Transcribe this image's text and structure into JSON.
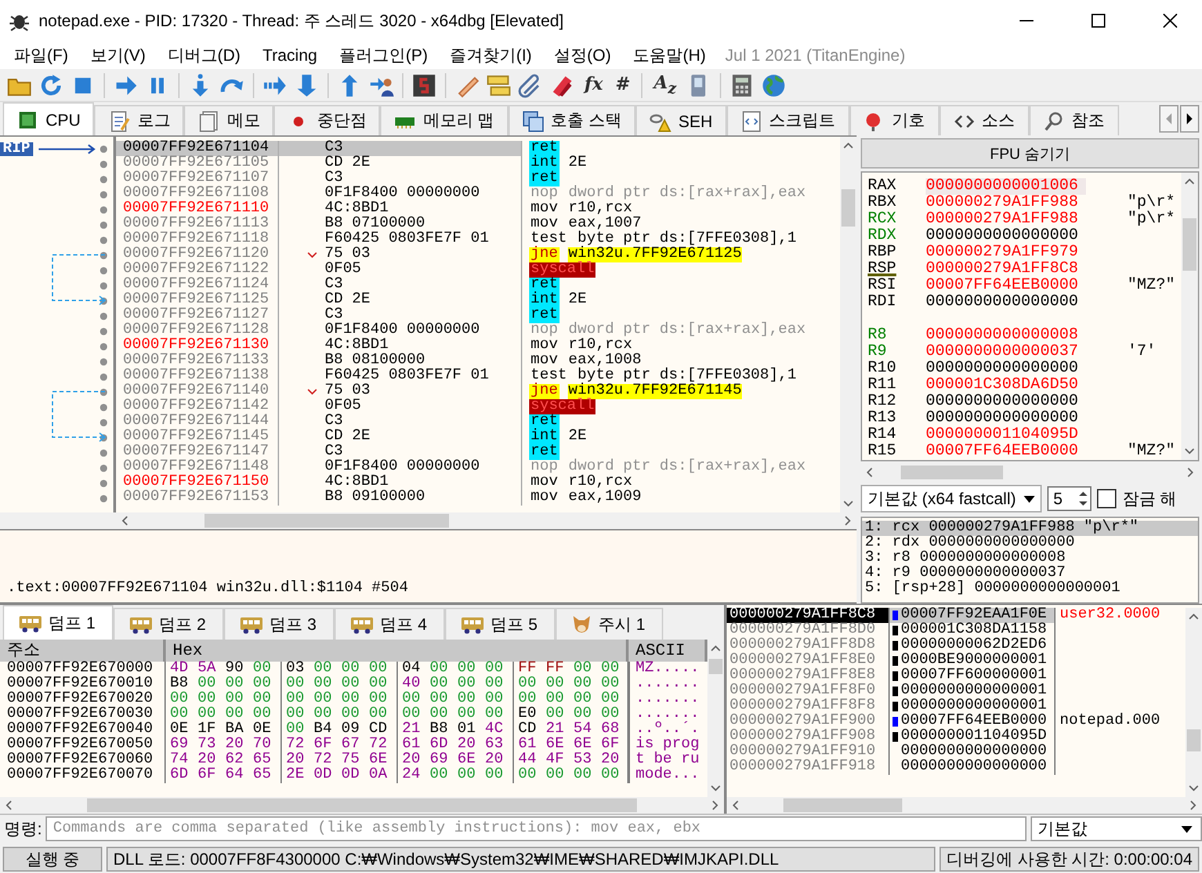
{
  "window": {
    "title": "notepad.exe - PID: 17320 - Thread: 주 스레드 3020 - x64dbg [Elevated]"
  },
  "menu": {
    "items": [
      "파일(F)",
      "보기(V)",
      "디버그(D)",
      "Tracing",
      "플러그인(P)",
      "즐겨찾기(I)",
      "설정(O)",
      "도움말(H)"
    ],
    "build_info": "Jul 1 2021 (TitanEngine)"
  },
  "toolbar": [
    {
      "kind": "open"
    },
    {
      "kind": "restart"
    },
    {
      "kind": "stop"
    },
    {
      "kind": "separator"
    },
    {
      "kind": "run"
    },
    {
      "kind": "pause"
    },
    {
      "kind": "separator"
    },
    {
      "kind": "step_into"
    },
    {
      "kind": "step_over"
    },
    {
      "kind": "separator"
    },
    {
      "kind": "trace_into"
    },
    {
      "kind": "trace_over"
    },
    {
      "kind": "separator"
    },
    {
      "kind": "run_till_return"
    },
    {
      "kind": "run_to_user"
    },
    {
      "kind": "separator"
    },
    {
      "kind": "plugin"
    },
    {
      "kind": "separator"
    },
    {
      "kind": "patches"
    },
    {
      "kind": "comments"
    },
    {
      "kind": "labels"
    },
    {
      "kind": "bookmarks"
    },
    {
      "kind": "glyph",
      "label": "fx"
    },
    {
      "kind": "glyph",
      "label": "#"
    },
    {
      "kind": "separator"
    },
    {
      "kind": "glyph",
      "label": "A$_{z}$"
    },
    {
      "kind": "device"
    },
    {
      "kind": "separator"
    },
    {
      "kind": "calculator"
    },
    {
      "kind": "globe"
    }
  ],
  "tabs": [
    {
      "label": "CPU",
      "selected": true
    },
    {
      "label": "로그",
      "selected": false
    },
    {
      "label": "메모",
      "selected": false
    },
    {
      "label": "중단점",
      "selected": false
    },
    {
      "label": "메모리 맵",
      "selected": false
    },
    {
      "label": "호출 스택",
      "selected": false
    },
    {
      "label": "SEH",
      "selected": false
    },
    {
      "label": "스크립트",
      "selected": false
    },
    {
      "label": "기호",
      "selected": false
    },
    {
      "label": "소스",
      "selected": false
    },
    {
      "label": "참조",
      "selected": false
    }
  ],
  "disassembly": {
    "rip_label": "RIP",
    "rows": [
      {
        "address": "00007FF92E671104",
        "color": "#000000",
        "bytes": "C3",
        "mnemonic": "ret",
        "kind": "ret",
        "branch_source": false,
        "branch_target": false,
        "selected": true
      },
      {
        "address": "00007FF92E671105",
        "color": "#808080",
        "bytes": "CD 2E",
        "mnemonic": "int",
        "operands": "2E",
        "kind": "int",
        "branch_source": false,
        "branch_target": false,
        "selected": false
      },
      {
        "address": "00007FF92E671107",
        "color": "#808080",
        "bytes": "C3",
        "mnemonic": "ret",
        "kind": "ret",
        "branch_source": false,
        "branch_target": false,
        "selected": false
      },
      {
        "address": "00007FF92E671108",
        "color": "#808080",
        "bytes": "0F1F8400 00000000",
        "mnemonic": "nop",
        "operands": "dword ptr ds:[rax+rax],eax",
        "kind": "nop",
        "branch_source": false,
        "branch_target": false,
        "selected": false
      },
      {
        "address": "00007FF92E671110",
        "color": "#ff0000",
        "bytes": "4C:8BD1",
        "mnemonic": "mov",
        "operands": "r10,rcx",
        "kind": "mov",
        "branch_source": false,
        "branch_target": false,
        "selected": false
      },
      {
        "address": "00007FF92E671113",
        "color": "#808080",
        "bytes": "B8 07100000",
        "mnemonic": "mov",
        "operands": "eax,1007",
        "kind": "mov",
        "branch_source": false,
        "branch_target": false,
        "selected": false
      },
      {
        "address": "00007FF92E671118",
        "color": "#808080",
        "bytes": "F60425 0803FE7F 01",
        "mnemonic": "test",
        "operands": "byte ptr ds:[7FFE0308],1",
        "kind": "test",
        "branch_source": false,
        "branch_target": false,
        "selected": false
      },
      {
        "address": "00007FF92E671120",
        "color": "#808080",
        "bytes": "75 03",
        "mnemonic": "jne",
        "operands": "win32u.7FF92E671125",
        "kind": "jne",
        "branch_source": true,
        "branch_target": false,
        "selected": false
      },
      {
        "address": "00007FF92E671122",
        "color": "#808080",
        "bytes": "0F05",
        "mnemonic": "syscall",
        "kind": "syscall",
        "branch_source": false,
        "branch_target": false,
        "selected": false
      },
      {
        "address": "00007FF92E671124",
        "color": "#808080",
        "bytes": "C3",
        "mnemonic": "ret",
        "kind": "ret",
        "branch_source": false,
        "branch_target": false,
        "selected": false
      },
      {
        "address": "00007FF92E671125",
        "color": "#808080",
        "bytes": "CD 2E",
        "mnemonic": "int",
        "operands": "2E",
        "kind": "int",
        "branch_source": false,
        "branch_target": true,
        "selected": false
      },
      {
        "address": "00007FF92E671127",
        "color": "#808080",
        "bytes": "C3",
        "mnemonic": "ret",
        "kind": "ret",
        "branch_source": false,
        "branch_target": false,
        "selected": false
      },
      {
        "address": "00007FF92E671128",
        "color": "#808080",
        "bytes": "0F1F8400 00000000",
        "mnemonic": "nop",
        "operands": "dword ptr ds:[rax+rax],eax",
        "kind": "nop",
        "branch_source": false,
        "branch_target": false,
        "selected": false
      },
      {
        "address": "00007FF92E671130",
        "color": "#ff0000",
        "bytes": "4C:8BD1",
        "mnemonic": "mov",
        "operands": "r10,rcx",
        "kind": "mov",
        "branch_source": false,
        "branch_target": false,
        "selected": false
      },
      {
        "address": "00007FF92E671133",
        "color": "#808080",
        "bytes": "B8 08100000",
        "mnemonic": "mov",
        "operands": "eax,1008",
        "kind": "mov",
        "branch_source": false,
        "branch_target": false,
        "selected": false
      },
      {
        "address": "00007FF92E671138",
        "color": "#808080",
        "bytes": "F60425 0803FE7F 01",
        "mnemonic": "test",
        "operands": "byte ptr ds:[7FFE0308],1",
        "kind": "test",
        "branch_source": false,
        "branch_target": false,
        "selected": false
      },
      {
        "address": "00007FF92E671140",
        "color": "#808080",
        "bytes": "75 03",
        "mnemonic": "jne",
        "operands": "win32u.7FF92E671145",
        "kind": "jne",
        "branch_source": true,
        "branch_target": false,
        "selected": false
      },
      {
        "address": "00007FF92E671142",
        "color": "#808080",
        "bytes": "0F05",
        "mnemonic": "syscall",
        "kind": "syscall",
        "branch_source": false,
        "branch_target": false,
        "selected": false
      },
      {
        "address": "00007FF92E671144",
        "color": "#808080",
        "bytes": "C3",
        "mnemonic": "ret",
        "kind": "ret",
        "branch_source": false,
        "branch_target": false,
        "selected": false
      },
      {
        "address": "00007FF92E671145",
        "color": "#808080",
        "bytes": "CD 2E",
        "mnemonic": "int",
        "operands": "2E",
        "kind": "int",
        "branch_source": false,
        "branch_target": true,
        "selected": false
      },
      {
        "address": "00007FF92E671147",
        "color": "#808080",
        "bytes": "C3",
        "mnemonic": "ret",
        "kind": "ret",
        "branch_source": false,
        "branch_target": false,
        "selected": false
      },
      {
        "address": "00007FF92E671148",
        "color": "#808080",
        "bytes": "0F1F8400 00000000",
        "mnemonic": "nop",
        "operands": "dword ptr ds:[rax+rax],eax",
        "kind": "nop",
        "branch_source": false,
        "branch_target": false,
        "selected": false
      },
      {
        "address": "00007FF92E671150",
        "color": "#ff0000",
        "bytes": "4C:8BD1",
        "mnemonic": "mov",
        "operands": "r10,rcx",
        "kind": "mov",
        "branch_source": false,
        "branch_target": false,
        "selected": false
      },
      {
        "address": "00007FF92E671153",
        "color": "#808080",
        "bytes": "B8 09100000",
        "mnemonic": "mov",
        "operands": "eax,1009",
        "kind": "mov",
        "branch_source": false,
        "branch_target": false,
        "selected": false
      }
    ]
  },
  "info_line": ".text:00007FF92E671104 win32u.dll:$1104 #504",
  "fpu_button": "FPU 숨기기",
  "registers": {
    "groups": [
      {
        "items": [
          {
            "name": "RAX",
            "color": "#000000",
            "value": "0000000000001006",
            "changed": true,
            "selected": true,
            "underlined": false
          },
          {
            "name": "RBX",
            "color": "#000000",
            "value": "000000279A1FF988",
            "changed": true,
            "selected": false,
            "underlined": false,
            "comment": "\"p\\r*"
          },
          {
            "name": "RCX",
            "color": "#008000",
            "value": "000000279A1FF988",
            "changed": true,
            "selected": false,
            "underlined": false,
            "comment": "\"p\\r*"
          },
          {
            "name": "RDX",
            "color": "#008000",
            "value": "0000000000000000",
            "changed": false,
            "selected": false,
            "underlined": false
          },
          {
            "name": "RBP",
            "color": "#000000",
            "value": "000000279A1FF979",
            "changed": true,
            "selected": false,
            "underlined": false
          },
          {
            "name": "RSP",
            "color": "#000000",
            "value": "000000279A1FF8C8",
            "changed": true,
            "selected": false,
            "underlined": true
          },
          {
            "name": "RSI",
            "color": "#000000",
            "value": "00007FF64EEB0000",
            "changed": true,
            "selected": false,
            "underlined": false,
            "comment": "\"MZ?\""
          },
          {
            "name": "RDI",
            "color": "#000000",
            "value": "0000000000000000",
            "changed": false,
            "selected": false,
            "underlined": false
          }
        ]
      },
      {
        "items": [
          {
            "name": "R8",
            "color": "#008000",
            "value": "0000000000000008",
            "changed": true,
            "selected": false,
            "underlined": false
          },
          {
            "name": "R9",
            "color": "#008000",
            "value": "0000000000000037",
            "changed": true,
            "selected": false,
            "underlined": false,
            "comment": "'7'"
          },
          {
            "name": "R10",
            "color": "#000000",
            "value": "0000000000000000",
            "changed": false,
            "selected": false,
            "underlined": false
          },
          {
            "name": "R11",
            "color": "#000000",
            "value": "000001C308DA6D50",
            "changed": true,
            "selected": false,
            "underlined": false
          },
          {
            "name": "R12",
            "color": "#000000",
            "value": "0000000000000000",
            "changed": false,
            "selected": false,
            "underlined": false
          },
          {
            "name": "R13",
            "color": "#000000",
            "value": "0000000000000000",
            "changed": false,
            "selected": false,
            "underlined": false
          },
          {
            "name": "R14",
            "color": "#000000",
            "value": "000000001104095D",
            "changed": true,
            "selected": false,
            "underlined": false
          },
          {
            "name": "R15",
            "color": "#000000",
            "value": "00007FF64EEB0000",
            "changed": true,
            "selected": false,
            "underlined": false,
            "comment": "\"MZ?\""
          }
        ]
      }
    ]
  },
  "call_convention": {
    "value": "기본값 (x64 fastcall)",
    "count": "5",
    "lock_label": "잠금 해",
    "lock_checked": false
  },
  "arguments": [
    {
      "text": "1: rcx 000000279A1FF988 \"p\\r*\"",
      "selected": true
    },
    {
      "text": "2: rdx 0000000000000000",
      "selected": false
    },
    {
      "text": "3: r8 0000000000000008",
      "selected": false
    },
    {
      "text": "4: r9 0000000000000037",
      "selected": false
    },
    {
      "text": "5: [rsp+28] 0000000000000001",
      "selected": false
    }
  ],
  "dump_tabs": [
    {
      "label": "덤프 1",
      "kind": "dump",
      "selected": true
    },
    {
      "label": "덤프 2",
      "kind": "dump",
      "selected": false
    },
    {
      "label": "덤프 3",
      "kind": "dump",
      "selected": false
    },
    {
      "label": "덤프 4",
      "kind": "dump",
      "selected": false
    },
    {
      "label": "덤프 5",
      "kind": "dump",
      "selected": false
    },
    {
      "label": "주시 1",
      "kind": "watch",
      "selected": false
    }
  ],
  "dump": {
    "columns": [
      "주소",
      "Hex",
      "ASCII"
    ],
    "rows": [
      {
        "address": "00007FF92E670000",
        "bytes": [
          "4D",
          "5A",
          "90",
          "00",
          "03",
          "00",
          "00",
          "00",
          "04",
          "00",
          "00",
          "00",
          "FF",
          "FF",
          "00",
          "00"
        ],
        "ascii": "MZ....."
      },
      {
        "address": "00007FF92E670010",
        "bytes": [
          "B8",
          "00",
          "00",
          "00",
          "00",
          "00",
          "00",
          "00",
          "40",
          "00",
          "00",
          "00",
          "00",
          "00",
          "00",
          "00"
        ],
        "ascii": "......."
      },
      {
        "address": "00007FF92E670020",
        "bytes": [
          "00",
          "00",
          "00",
          "00",
          "00",
          "00",
          "00",
          "00",
          "00",
          "00",
          "00",
          "00",
          "00",
          "00",
          "00",
          "00"
        ],
        "ascii": "......."
      },
      {
        "address": "00007FF92E670030",
        "bytes": [
          "00",
          "00",
          "00",
          "00",
          "00",
          "00",
          "00",
          "00",
          "00",
          "00",
          "00",
          "00",
          "E0",
          "00",
          "00",
          "00"
        ],
        "ascii": "......."
      },
      {
        "address": "00007FF92E670040",
        "bytes": [
          "0E",
          "1F",
          "BA",
          "0E",
          "00",
          "B4",
          "09",
          "CD",
          "21",
          "B8",
          "01",
          "4C",
          "CD",
          "21",
          "54",
          "68"
        ],
        "ascii": "..º..´."
      },
      {
        "address": "00007FF92E670050",
        "bytes": [
          "69",
          "73",
          "20",
          "70",
          "72",
          "6F",
          "67",
          "72",
          "61",
          "6D",
          "20",
          "63",
          "61",
          "6E",
          "6E",
          "6F"
        ],
        "ascii": "is prog"
      },
      {
        "address": "00007FF92E670060",
        "bytes": [
          "74",
          "20",
          "62",
          "65",
          "20",
          "72",
          "75",
          "6E",
          "20",
          "69",
          "6E",
          "20",
          "44",
          "4F",
          "53",
          "20"
        ],
        "ascii": "t be ru"
      },
      {
        "address": "00007FF92E670070",
        "bytes": [
          "6D",
          "6F",
          "64",
          "65",
          "2E",
          "0D",
          "0D",
          "0A",
          "24",
          "00",
          "00",
          "00",
          "00",
          "00",
          "00",
          "00"
        ],
        "ascii": "mode..."
      }
    ]
  },
  "stack": {
    "rows": [
      {
        "address": "000000279A1FF8C8",
        "kind": "return",
        "value": "00007FF92EAA1F0E",
        "comment": "user32.0000",
        "color": "#ff0000",
        "selected": true
      },
      {
        "address": "000000279A1FF8D0",
        "kind": "pointer",
        "value": "000001C308DA1158",
        "selected": false
      },
      {
        "address": "000000279A1FF8D8",
        "kind": "pointer",
        "value": "00000000062D2ED6",
        "selected": false
      },
      {
        "address": "000000279A1FF8E0",
        "kind": "pointer",
        "value": "0000BE9000000001",
        "selected": false
      },
      {
        "address": "000000279A1FF8E8",
        "kind": "pointer",
        "value": "00007FF600000001",
        "selected": false
      },
      {
        "address": "000000279A1FF8F0",
        "kind": "pointer",
        "value": "0000000000000001",
        "selected": false
      },
      {
        "address": "000000279A1FF8F8",
        "kind": "pointer",
        "value": "0000000000000001",
        "selected": false
      },
      {
        "address": "000000279A1FF900",
        "kind": "return",
        "value": "00007FF64EEB0000",
        "comment": "notepad.000",
        "color": "#000000",
        "selected": false
      },
      {
        "address": "000000279A1FF908",
        "kind": "pointer",
        "value": "000000001104095D",
        "selected": false
      },
      {
        "address": "000000279A1FF910",
        "kind": "plain",
        "value": "0000000000000000",
        "selected": false
      },
      {
        "address": "000000279A1FF918",
        "kind": "plain",
        "value": "0000000000000000",
        "selected": false
      }
    ]
  },
  "command": {
    "label": "명령:",
    "placeholder": "Commands are comma separated (like assembly instructions): mov eax, ebx",
    "mode": "기본값"
  },
  "status": {
    "state": "실행 중",
    "message": "DLL 로드: 00007FF8F4300000 C:₩Windows₩System32₩IME₩SHARED₩IMJKAPI.DLL",
    "time": "디버깅에 사용한 시간: 0:00:00:04"
  }
}
